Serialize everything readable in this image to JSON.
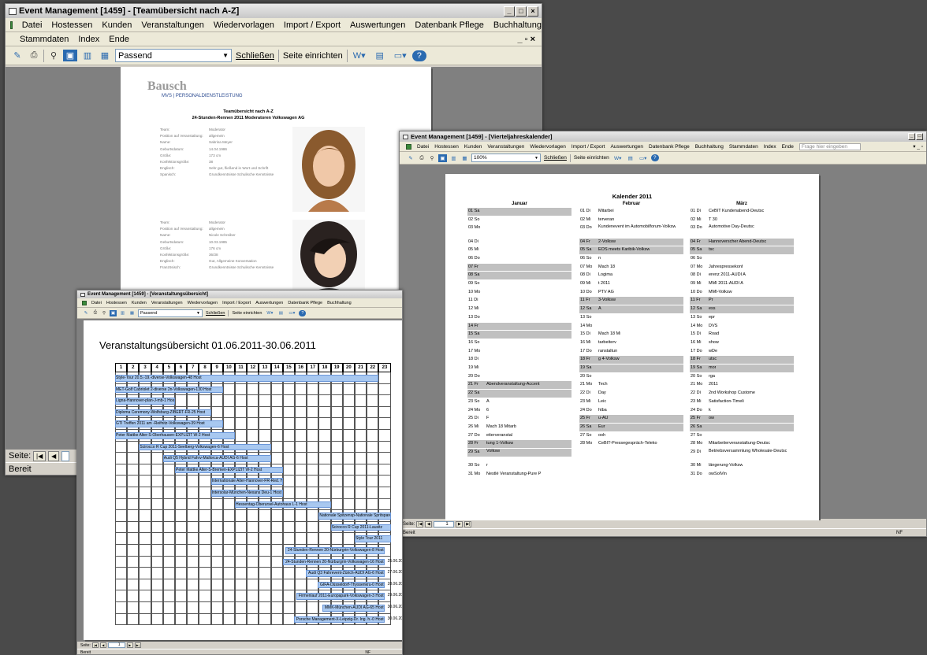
{
  "win1": {
    "title": "Event Management [1459] - [Teamübersicht nach A-Z]",
    "menu1": [
      "Datei",
      "Hostessen",
      "Kunden",
      "Veranstaltungen",
      "Wiedervorlagen",
      "Import / Export",
      "Auswertungen",
      "Datenbank Pflege",
      "Buchhaltung"
    ],
    "menu2": [
      "Stammdaten",
      "Index",
      "Ende"
    ],
    "zoom": "Passend",
    "close_label": "Schließen",
    "setup_label": "Seite einrichten",
    "seite_label": "Seite:",
    "status": "Bereit",
    "report": {
      "logo": "Bausch",
      "subline": "MVS | PERSONALDIENSTLEISTUNG",
      "heading1": "Teamübersicht nach A-Z",
      "heading2": "24-Stunden-Rennen 2011 Moderatoren Volkswagen AG",
      "persons": [
        {
          "fields": [
            [
              "Team:",
              "Moderator"
            ],
            [
              "Position auf Veranstaltung:",
              "allgemein"
            ],
            [
              "Name:",
              "Sabrina Meyer"
            ],
            [
              "Geburtsdatum:",
              "14.04.1986"
            ],
            [
              "Größe:",
              "173 cm"
            ],
            [
              "Konfektionsgröße:",
              "38"
            ],
            [
              "Englisch:",
              "Sehr gut, fließend in Wort und Schrift"
            ],
            [
              "Spanisch:",
              "Grundkenntnisse Schulische Kenntnisse"
            ]
          ]
        },
        {
          "fields": [
            [
              "Team:",
              "Moderator"
            ],
            [
              "Position auf Veranstaltung:",
              "allgemein"
            ],
            [
              "Name:",
              "Nicole Schreiber"
            ],
            [
              "Geburtsdatum:",
              "10.03.1985"
            ],
            [
              "Größe:",
              "176 cm"
            ],
            [
              "Konfektionsgröße:",
              "36/38"
            ],
            [
              "Englisch:",
              "Gut, Allgemeine Konversation"
            ],
            [
              "Französisch:",
              "Grundkenntnisse Schulische Kenntnisse"
            ]
          ]
        }
      ]
    }
  },
  "win2": {
    "title": "Event Management [1459] - [Vierteljahreskalender]",
    "menu": [
      "Datei",
      "Hostessen",
      "Kunden",
      "Veranstaltungen",
      "Wiedervorlagen",
      "Import / Export",
      "Auswertungen",
      "Datenbank Pflege",
      "Buchhaltung",
      "Stammdaten",
      "Index",
      "Ende"
    ],
    "help_placeholder": "Frage hier eingeben",
    "zoom": "100%",
    "close_label": "Schließen",
    "setup_label": "Seite einrichten",
    "seite_label": "Seite:",
    "page_num": "1",
    "status": "Bereit",
    "nf": "NF",
    "report_title": "Kalender 2011",
    "months": [
      "Januar",
      "Februar",
      "März"
    ],
    "rows": [
      [
        [
          "01 Sa",
          "",
          1
        ],
        [
          "01 Di",
          "Mitarbei",
          0
        ],
        [
          "01 Di",
          "CeBIT Kundenabend-Deutsc",
          0
        ]
      ],
      [
        [
          "02 So",
          "",
          0
        ],
        [
          "02 Mi",
          "terveran",
          0
        ],
        [
          "02 Mi",
          "T 30",
          0
        ]
      ],
      [
        [
          "03 Mo",
          "",
          0
        ],
        [
          "03 Do",
          "Kundenevent im Automobilforum-Volksw",
          0
        ],
        [
          "03 Do",
          "Automotive Day-Deutsc",
          0
        ]
      ],
      [
        [
          "04 Di",
          "",
          0
        ],
        [
          "04 Fr",
          "2-Volksw",
          1
        ],
        [
          "04 Fr",
          "Hannoverscher Abend-Deutsc",
          1
        ]
      ],
      [
        [
          "05 Mi",
          "",
          0
        ],
        [
          "05 Sa",
          "EOS meets Karibik-Volksw",
          1
        ],
        [
          "05 Sa",
          "tsc",
          1
        ]
      ],
      [
        [
          "06 Do",
          "",
          0
        ],
        [
          "06 So",
          "n",
          0
        ],
        [
          "06 So",
          "",
          0
        ]
      ],
      [
        [
          "07 Fr",
          "",
          1
        ],
        [
          "07 Mo",
          "Mach 18",
          0
        ],
        [
          "07 Mo",
          "Jahrespressekonf",
          0
        ]
      ],
      [
        [
          "08 Sa",
          "",
          1
        ],
        [
          "08 Di",
          "Logima",
          0
        ],
        [
          "08 Di",
          "erenz 2011-AUDI A",
          0
        ]
      ],
      [
        [
          "09 So",
          "",
          0
        ],
        [
          "09 Mi",
          "t 2011",
          0
        ],
        [
          "09 Mi",
          "MMI 2011-AUDI A",
          0
        ]
      ],
      [
        [
          "10 Mo",
          "",
          0
        ],
        [
          "10 Do",
          "PTV AG",
          0
        ],
        [
          "10 Do",
          "MMI-Volksw",
          0
        ]
      ],
      [
        [
          "11 Di",
          "",
          0
        ],
        [
          "11 Fr",
          "3-Volksw",
          1
        ],
        [
          "11 Fr",
          "Pr",
          1
        ]
      ],
      [
        [
          "12 Mi",
          "",
          0
        ],
        [
          "12 Sa",
          "A",
          1
        ],
        [
          "12 Sa",
          "ess",
          1
        ]
      ],
      [
        [
          "13 Do",
          "",
          0
        ],
        [
          "13 So",
          "",
          0
        ],
        [
          "13 So",
          "epr",
          0
        ]
      ],
      [
        [
          "14 Fr",
          "",
          1
        ],
        [
          "14 Mo",
          "",
          0
        ],
        [
          "14 Mo",
          "DVS",
          0
        ]
      ],
      [
        [
          "15 Sa",
          "",
          1
        ],
        [
          "15 Di",
          "Mach 18 Mi",
          0
        ],
        [
          "15 Di",
          "Road",
          0
        ]
      ],
      [
        [
          "16 So",
          "",
          0
        ],
        [
          "16 Mi",
          "tarbeiterv",
          0
        ],
        [
          "16 Mi",
          "show",
          0
        ]
      ],
      [
        [
          "17 Mo",
          "",
          0
        ],
        [
          "17 Do",
          "ranstaltun",
          0
        ],
        [
          "17 Do",
          "wDe",
          0
        ]
      ],
      [
        [
          "18 Di",
          "",
          0
        ],
        [
          "18 Fr",
          "g 4-Volksw",
          1
        ],
        [
          "18 Fr",
          "utsc",
          1
        ]
      ],
      [
        [
          "19 Mi",
          "",
          0
        ],
        [
          "19 Sa",
          "",
          1
        ],
        [
          "19 Sa",
          "mor",
          1
        ]
      ],
      [
        [
          "20 Do",
          "",
          0
        ],
        [
          "20 So",
          "",
          0
        ],
        [
          "20 So",
          "rga",
          0
        ]
      ],
      [
        [
          "21 Fr",
          "Abendveranstaltung-Accent",
          1
        ],
        [
          "21 Mo",
          "Tech",
          0
        ],
        [
          "21 Mo",
          "2011",
          0
        ]
      ],
      [
        [
          "22 Sa",
          "",
          1
        ],
        [
          "22 Di",
          "Day",
          0
        ],
        [
          "22 Di",
          "2nd Workshop Custome",
          0
        ]
      ],
      [
        [
          "23 So",
          "A",
          0
        ],
        [
          "23 Mi",
          "Leic",
          0
        ],
        [
          "23 Mi",
          "Satisfaction-Timeli",
          0
        ]
      ],
      [
        [
          "24 Mo",
          "6",
          0
        ],
        [
          "24 Do",
          "htba",
          0
        ],
        [
          "24 Do",
          "k",
          0
        ]
      ],
      [
        [
          "25 Di",
          "F",
          0
        ],
        [
          "25 Fr",
          "u-AU",
          1
        ],
        [
          "25 Fr",
          "ow",
          1
        ]
      ],
      [
        [
          "26 Mi",
          "Mach 18 Mitarb",
          0
        ],
        [
          "26 Sa",
          "Eur",
          1
        ],
        [
          "26 Sa",
          "",
          1
        ]
      ],
      [
        [
          "27 Do",
          "eiterveranstal",
          0
        ],
        [
          "27 So",
          "ooh",
          0
        ],
        [
          "27 So",
          "",
          0
        ]
      ],
      [
        [
          "28 Fr",
          "tung 1-Volksw",
          1
        ],
        [
          "28 Mo",
          "CeBIT-Pressegespräch-Teleko",
          0
        ],
        [
          "28 Mo",
          "Mitarbeiterveranstaltung-Deutsc",
          0
        ]
      ],
      [
        [
          "29 Sa",
          "Volksw",
          1
        ],
        [
          "",
          "",
          0
        ],
        [
          "29 Di",
          "Betriebsversammlung Wholesale-Deutsc",
          0
        ]
      ],
      [
        [
          "30 So",
          "r",
          0
        ],
        [
          "",
          "",
          0
        ],
        [
          "30 Mi",
          "längerung-Volksw",
          0
        ]
      ],
      [
        [
          "31 Mo",
          "Nestlé Veranstaltung-Pure P",
          0
        ],
        [
          "",
          "",
          0
        ],
        [
          "31 Do",
          "owSolVin",
          0
        ]
      ]
    ]
  },
  "win3": {
    "title": "Event Management [1459] - [Veranstaltungsübersicht]",
    "menu": [
      "Datei",
      "Hostessen",
      "Kunden",
      "Veranstaltungen",
      "Wiedervorlagen",
      "Import / Export",
      "Auswertungen",
      "Datenbank Pflege",
      "Buchhaltung"
    ],
    "zoom": "Passend",
    "close_label": "Schließen",
    "setup_label": "Seite einrichten",
    "seite_label": "Seite:",
    "page_num": "1",
    "status": "Bereit",
    "nf": "NF",
    "report_title": "Veranstaltungsübersicht 01.06.2011-30.06.2011",
    "days": [
      "1",
      "2",
      "3",
      "4",
      "5",
      "6",
      "7",
      "8",
      "9",
      "10",
      "11",
      "12",
      "13",
      "14",
      "15",
      "16",
      "17",
      "18",
      "19",
      "20",
      "21",
      "22",
      "23"
    ],
    "events": [
      {
        "label": "Style-Tour 20.5.-19.-diverse-Volkswagen-48 Host",
        "start": 1,
        "end": 22
      },
      {
        "label": "MET-Golf Cabriolet 2-diverse 2n-Volkswagen-130 Host",
        "start": 1,
        "end": 9
      },
      {
        "label": "Ligna-Hannover-plan-J-mb-1 Host",
        "start": 1,
        "end": 5
      },
      {
        "label": "Diploma Ceremony-Wolfsburg-ZIBERT-FR-25 Host",
        "start": 1,
        "end": 8
      },
      {
        "label": "GTI Treffen 2011 am -Reifnitz-Volkswagen-39 Host",
        "start": 1,
        "end": 9
      },
      {
        "label": "Peter Mattke Alter-S-Oberhausen-EXPLIZIT W-2 Host",
        "start": 1,
        "end": 10
      },
      {
        "label": "Scirocco R Cup 2011-Seelberg-Volkswagen-6 Host",
        "start": 3,
        "end": 13
      },
      {
        "label": "Audi Q5 Hybrid Fahrv-Mallorca-AUDI AG-6 Host",
        "start": 5,
        "end": 13
      },
      {
        "label": "Peter Mattke Alter-S-Bremen-EXPLIZIT W-2 Host",
        "start": 6,
        "end": 14
      },
      {
        "label": "Internationale Alter-Hannover-FR-Red. Hi-2 Host",
        "start": 9,
        "end": 14
      },
      {
        "label": "Intersolar-München-Nexans Deu-1 Host",
        "start": 9,
        "end": 14
      },
      {
        "label": "Hessentag-Oberursel-Autohaus L-1 Host",
        "start": 11,
        "end": 18
      },
      {
        "label": "Nationale Spitzensp-Nationale Spritsparen-kundeg",
        "start": 18,
        "end": 23
      },
      {
        "label": "Scirocco R Cup 2011-Lausitz",
        "start": 19,
        "end": 23
      },
      {
        "label": "Style Tour 2011",
        "start": 21,
        "end": 23
      }
    ],
    "detail_rows": [
      {
        "label": "24-Stunden-Rennen 20-Nürburgrin-Volkswagen-8 Host",
        "dates": ""
      },
      {
        "label": "24-Stunden-Rennen 20-Nürburgrin-Volkswagen-16 Host",
        "dates": "25.06.2011  25.06.2011"
      },
      {
        "label": "Audi Q3 Fahrevent-Zürich-AUDI AG-6 Host",
        "dates": "27.06.2011  09.07.2011"
      },
      {
        "label": "GIFA-Düsseldorf-Thyssenkru-0 Host",
        "dates": "28.06.2011  02.07.2011"
      },
      {
        "label": "Firmenlauf 2011-Europapark-Volkswagen-3 Host",
        "dates": "29.06.2011  30.06.2011"
      },
      {
        "label": "MMK-München-AUDI AG-65 Host",
        "dates": "30.06.2011  02.07.2011"
      },
      {
        "label": "Porsche Management-X-Leipzig-Dr. Ing. h.-0 Host",
        "dates": "30.06.2011  30.06.2011"
      }
    ]
  }
}
